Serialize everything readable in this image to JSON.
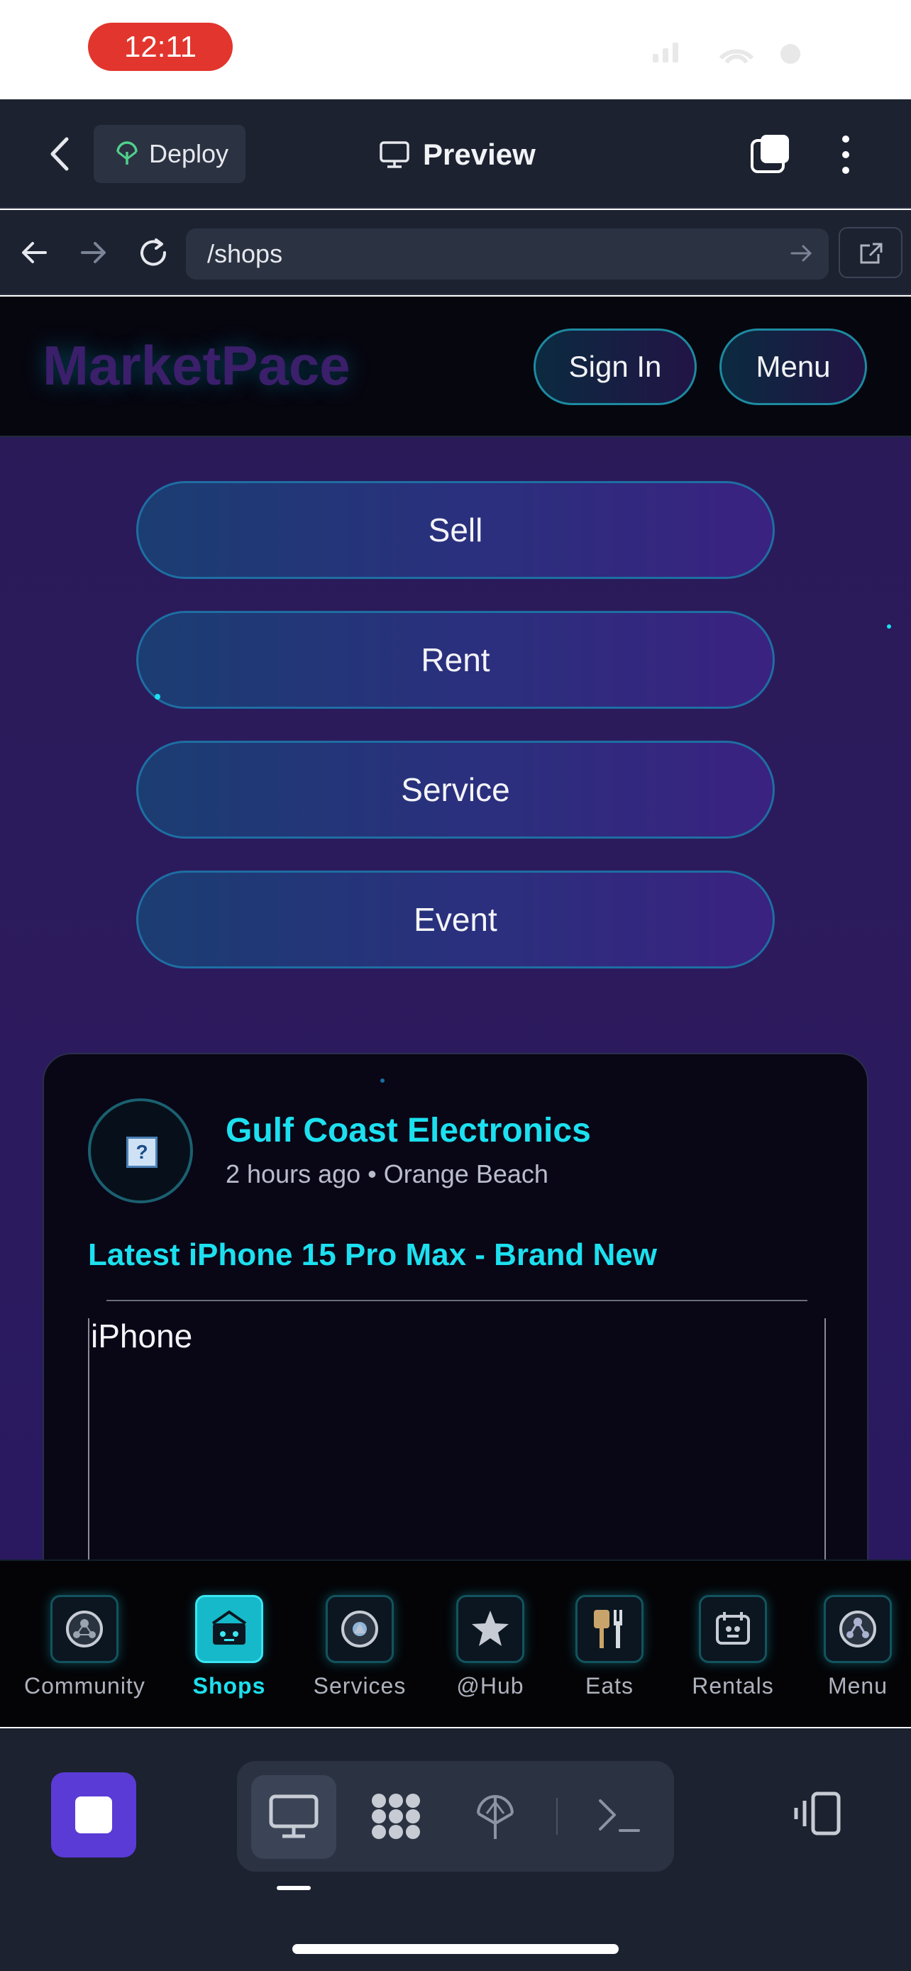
{
  "status_bar": {
    "time": "12:11"
  },
  "top_bar": {
    "deploy_label": "Deploy",
    "title": "Preview"
  },
  "url_bar": {
    "url": "/shops"
  },
  "site": {
    "logo": "MarketPace",
    "sign_in_label": "Sign In",
    "menu_label": "Menu",
    "actions": [
      "Sell",
      "Rent",
      "Service",
      "Event"
    ],
    "card": {
      "shop_name": "Gulf Coast Electronics",
      "meta": "2 hours ago • Orange Beach",
      "listing_title": "Latest iPhone 15 Pro Max - Brand New",
      "image_alt": "iPhone",
      "avatar_placeholder": "?"
    },
    "bottom_nav": [
      {
        "label": "Community",
        "icon": "community-icon",
        "active": false
      },
      {
        "label": "Shops",
        "icon": "shop-icon",
        "active": true
      },
      {
        "label": "Services",
        "icon": "services-icon",
        "active": false
      },
      {
        "label": "@Hub",
        "icon": "star-icon",
        "active": false
      },
      {
        "label": "Eats",
        "icon": "utensils-icon",
        "active": false
      },
      {
        "label": "Rentals",
        "icon": "calendar-icon",
        "active": false
      },
      {
        "label": "Menu",
        "icon": "menu-network-icon",
        "active": false
      }
    ]
  },
  "colors": {
    "accent_cyan": "#1ce0ef",
    "stop_button": "#5a3bd6",
    "clock_pill": "#e2352d"
  }
}
